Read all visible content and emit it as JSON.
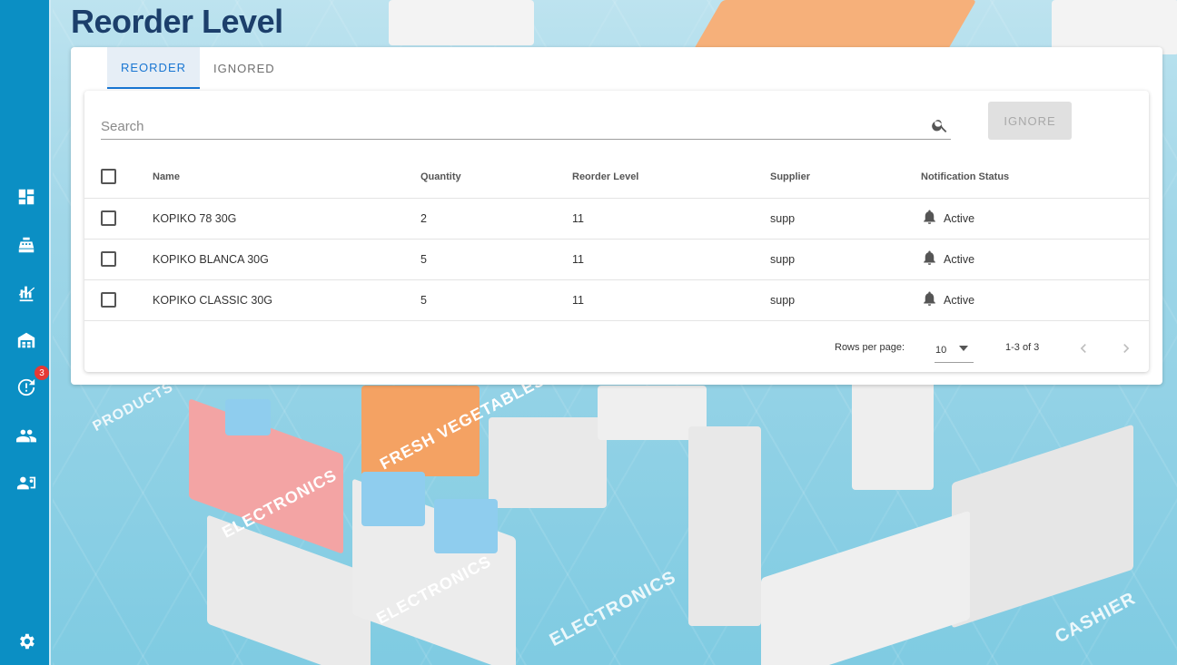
{
  "page": {
    "title": "Reorder Level"
  },
  "sidebar": {
    "items": [
      {
        "name": "dashboard-icon"
      },
      {
        "name": "cash-register-icon"
      },
      {
        "name": "sales-chart-icon"
      },
      {
        "name": "warehouse-icon"
      },
      {
        "name": "reorder-alert-icon",
        "badge": "3"
      },
      {
        "name": "users-icon"
      },
      {
        "name": "contacts-icon"
      },
      {
        "name": "settings-gear-icon"
      }
    ]
  },
  "tabs": [
    {
      "label": "REORDER",
      "active": true
    },
    {
      "label": "IGNORED",
      "active": false
    }
  ],
  "search": {
    "placeholder": "Search",
    "value": ""
  },
  "ignore_button": {
    "label": "IGNORE"
  },
  "table": {
    "headers": [
      "Name",
      "Quantity",
      "Reorder Level",
      "Supplier",
      "Notification Status"
    ],
    "rows": [
      {
        "name": "KOPIKO 78 30G",
        "quantity": "2",
        "reorder_level": "11",
        "supplier": "supp",
        "status": "Active"
      },
      {
        "name": "KOPIKO BLANCA 30G",
        "quantity": "5",
        "reorder_level": "11",
        "supplier": "supp",
        "status": "Active"
      },
      {
        "name": "KOPIKO CLASSIC 30G",
        "quantity": "5",
        "reorder_level": "11",
        "supplier": "supp",
        "status": "Active"
      }
    ]
  },
  "pagination": {
    "rows_per_page_label": "Rows per page:",
    "rows_per_page": "10",
    "range": "1-3 of 3"
  },
  "colors": {
    "sidebar": "#0b8fc4",
    "accent": "#1976d2",
    "title": "#1c3f6b",
    "badge": "#e53935"
  }
}
